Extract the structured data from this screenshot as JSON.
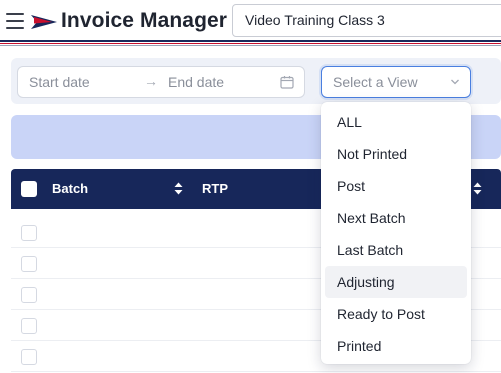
{
  "header": {
    "app_title": "Invoice Manager",
    "class_field_value": "Video Training Class 3",
    "icons": {
      "menu": "hamburger-menu-icon",
      "logo": "swoosh-logo"
    },
    "colors": {
      "navy": "#17275a",
      "red": "#c8102e"
    }
  },
  "filters": {
    "start_placeholder": "Start date",
    "arrow": "→",
    "end_placeholder": "End date",
    "view_placeholder": "Select a View",
    "icons": {
      "calendar": "calendar-icon",
      "dropdown": "chevron-down-icon"
    }
  },
  "table": {
    "columns": [
      {
        "label": "Batch"
      },
      {
        "label": "RTP"
      }
    ],
    "row_count": 5,
    "header_color": "#17275a"
  },
  "view_menu": {
    "items": [
      "ALL",
      "Not Printed",
      "Post",
      "Next Batch",
      "Last Batch",
      "Adjusting",
      "Ready to Post",
      "Printed"
    ],
    "hovered_item": "Adjusting"
  }
}
